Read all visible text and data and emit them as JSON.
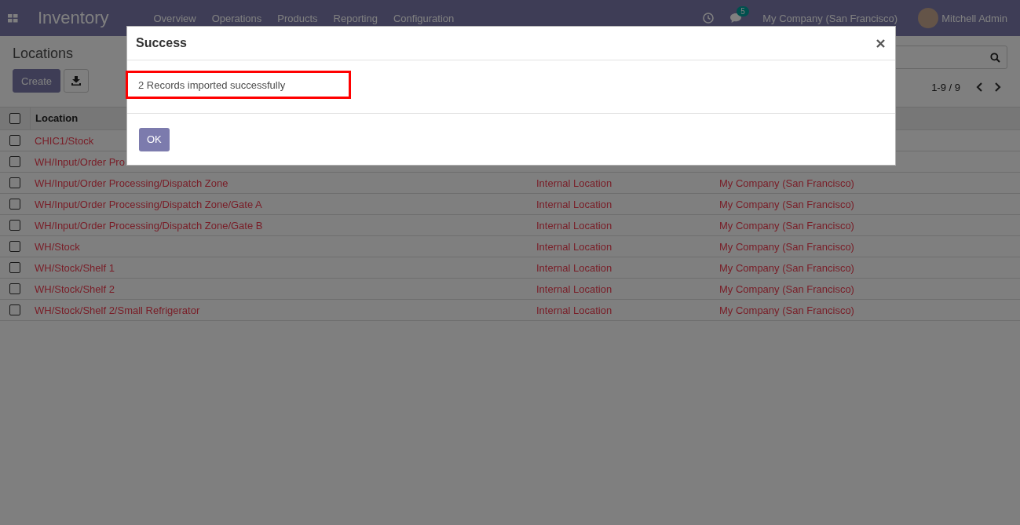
{
  "navbar": {
    "app_title": "Inventory",
    "menu": [
      "Overview",
      "Operations",
      "Products",
      "Reporting",
      "Configuration"
    ],
    "message_count": "5",
    "company": "My Company (San Francisco)",
    "user": "Mitchell Admin"
  },
  "control_panel": {
    "title": "Locations",
    "create_button": "Create",
    "pager": "1-9 / 9"
  },
  "table": {
    "select_all_checked": false,
    "columns": [
      "Location"
    ],
    "rows": [
      {
        "checked": false,
        "location": "CHIC1/Stock"
      },
      {
        "checked": false,
        "location": "WH/Input/Order Pro"
      },
      {
        "checked": false,
        "location": "WH/Input/Order Processing/Dispatch Zone",
        "type": "Internal Location",
        "company": "My Company (San Francisco)"
      },
      {
        "checked": false,
        "location": "WH/Input/Order Processing/Dispatch Zone/Gate A",
        "type": "Internal Location",
        "company": "My Company (San Francisco)"
      },
      {
        "checked": false,
        "location": "WH/Input/Order Processing/Dispatch Zone/Gate B",
        "type": "Internal Location",
        "company": "My Company (San Francisco)"
      },
      {
        "checked": false,
        "location": "WH/Stock",
        "type": "Internal Location",
        "company": "My Company (San Francisco)"
      },
      {
        "checked": false,
        "location": "WH/Stock/Shelf 1",
        "type": "Internal Location",
        "company": "My Company (San Francisco)"
      },
      {
        "checked": false,
        "location": "WH/Stock/Shelf 2",
        "type": "Internal Location",
        "company": "My Company (San Francisco)"
      },
      {
        "checked": false,
        "location": "WH/Stock/Shelf 2/Small Refrigerator",
        "type": "Internal Location",
        "company": "My Company (San Francisco)"
      }
    ]
  },
  "dialog": {
    "title": "Success",
    "message": "2 Records imported successfully",
    "message_highlighted": true,
    "ok_button": "OK"
  }
}
